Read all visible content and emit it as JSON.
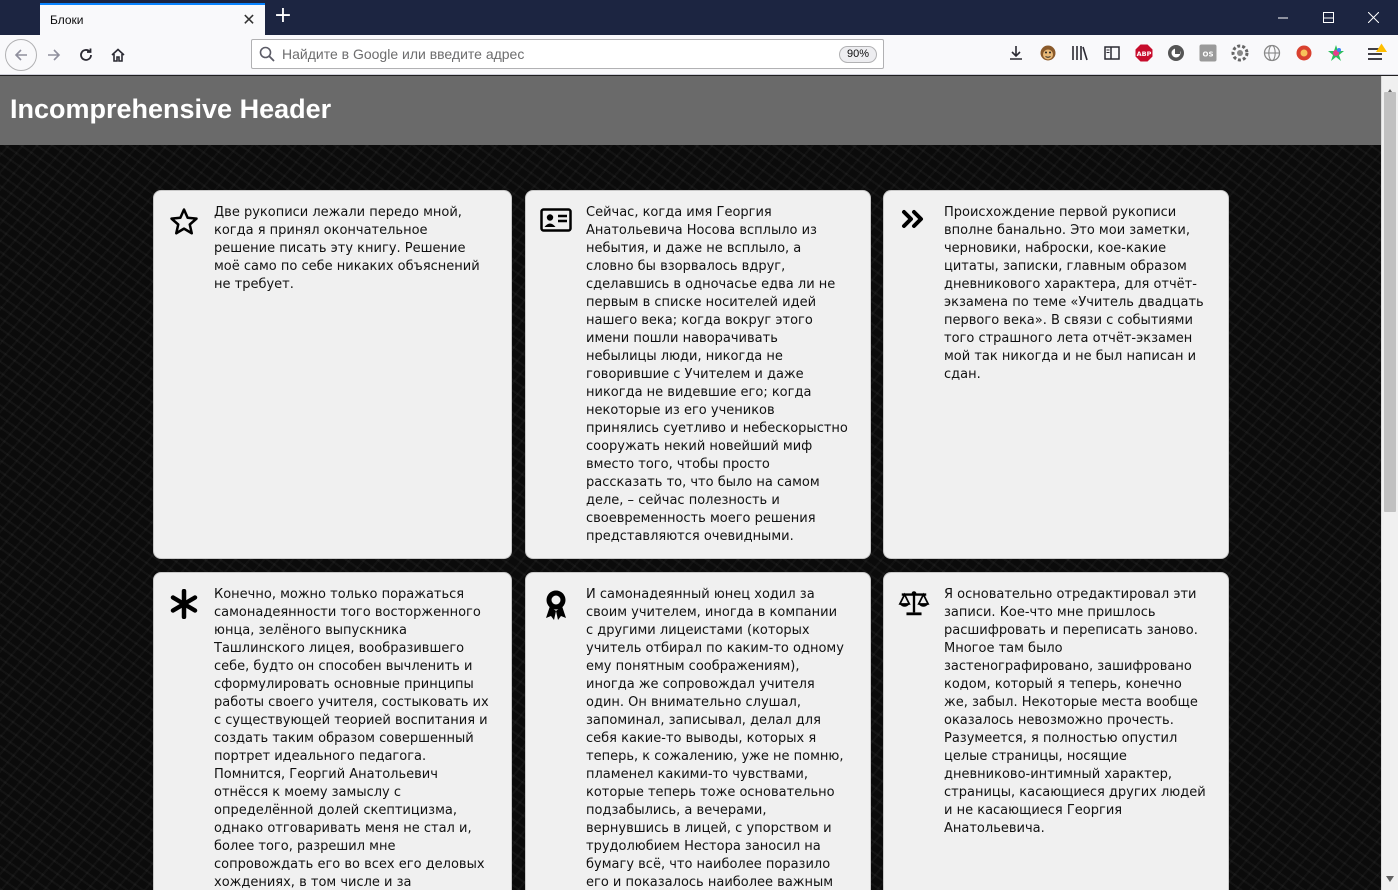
{
  "browser": {
    "tab_title": "Блоки",
    "tab_close": "✕",
    "new_tab": "+",
    "url_placeholder": "Найдите в Google или введите адрес",
    "url_value": "",
    "zoom": "90%",
    "toolbar_icons": [
      "download-icon",
      "monkey-icon",
      "library-icon",
      "sidebar-icon",
      "abp-icon",
      "privacy-icon",
      "os-icon",
      "gear-extension-icon",
      "globe-icon",
      "red-extension-icon",
      "puzzle-extension-icon"
    ],
    "abp_label": "ABP",
    "os_label": "OS",
    "colors": {
      "tabbar": "#1c2541",
      "accent": "#0a84ff"
    }
  },
  "page": {
    "title": "Incomprehensive Header",
    "colors": {
      "header": "#6a6a6a",
      "card": "#f0f0f0",
      "background": "#0b0b0b"
    },
    "cards": [
      {
        "icon": "star-icon",
        "text": "Две рукописи лежали передо мной, когда я принял окончательное решение писать эту книгу. Решение моё само по себе никаких объяснений не требует."
      },
      {
        "icon": "id-card-icon",
        "text": "Сейчас, когда имя Георгия Анатольевича Носова всплыло из небытия, и даже не всплыло, а словно бы взорвалось вдруг, сделавшись в одночасье едва ли не первым в списке носителей идей нашего века; когда вокруг этого имени пошли наворачивать небылицы люди, никогда не говорившие с Учителем и даже никогда не видевшие его; когда некоторые из его учеников принялись суетливо и небескорыстно сооружать некий новейший миф вместо того, чтобы просто рассказать то, что было на самом деле, – сейчас полезность и своевременность моего решения представляются очевидными."
      },
      {
        "icon": "double-chevron-right-icon",
        "text": "Происхождение первой рукописи вполне банально. Это мои заметки, черновики, наброски, кое-какие цитаты, записки, главным образом дневникового характера, для отчёт-экзамена по теме «Учитель двадцать первого века». В связи с событиями того страшного лета отчёт-экзамен мой так никогда и не был написан и сдан."
      },
      {
        "icon": "asterisk-icon",
        "text": "Конечно, можно только поражаться самонадеянности того восторженного юнца, зелёного выпускника Ташлинского лицея, вообразившего себе, будто он способен вычленить и сформулировать основные принципы работы своего учителя, состыковать их с существующей теорией воспитания и создать таким образом совершенный портрет идеального педагога. Помнится, Георгий Анатольевич отнёсся к моему замыслу с определённой долей скептицизма, однако отговаривать меня не стал и, более того, разрешил мне сопровождать его во всех его деловых хождениях, в том числе и за"
      },
      {
        "icon": "award-ribbon-icon",
        "text": "И самонадеянный юнец ходил за своим учителем, иногда в компании с другими лицеистами (которых учитель отбирал по каким-то одному ему понятным соображениям), иногда же сопровождал учителя один. Он внимательно слушал, запоминал, записывал, делал для себя какие-то выводы, которых я теперь, к сожалению, уже не помню, пламенел какими-то чувствами, которые теперь тоже основательно подзабылись, а вечерами, вернувшись в лицей, с упорством и трудолюбием Нестора заносил на бумагу всё, что наиболее поразило его и показалось наиболее важным"
      },
      {
        "icon": "balance-scale-icon",
        "text": "Я основательно отредактировал эти записи. Кое-что мне пришлось расшифровать и переписать заново. Многое там было застенографировано, зашифровано кодом, который я теперь, конечно же, забыл. Некоторые места вообще оказалось невозможно прочесть. Разумеется, я полностью опустил целые страницы, носящие дневниково-интимный характер, страницы, касающиеся других людей и не касающиеся Георгия Анатольевича."
      }
    ]
  }
}
